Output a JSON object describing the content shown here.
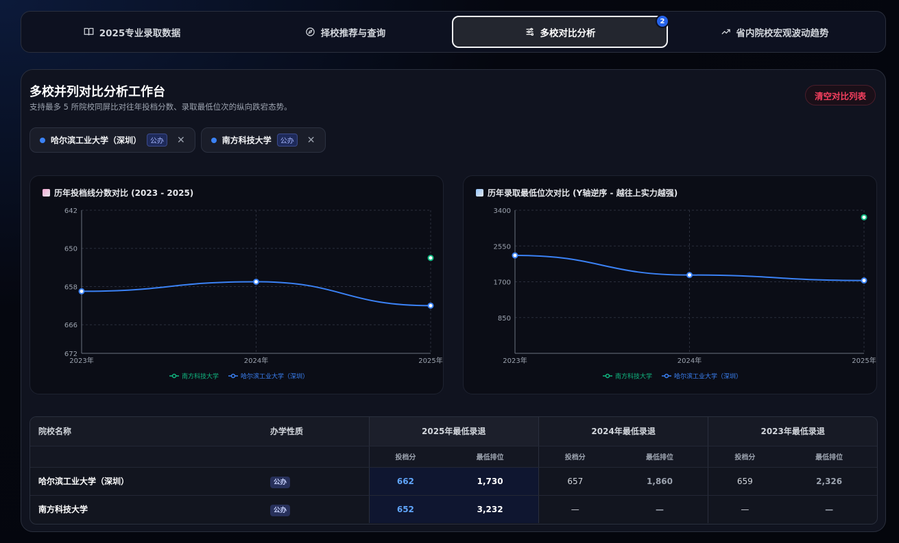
{
  "tabs": [
    {
      "label": "2025专业录取数据",
      "icon": "book-icon",
      "active": false
    },
    {
      "label": "择校推荐与查询",
      "icon": "compass-icon",
      "active": false
    },
    {
      "label": "多校对比分析",
      "icon": "sliders-icon",
      "active": true,
      "badge": "2"
    },
    {
      "label": "省内院校宏观波动趋势",
      "icon": "trend-up-icon",
      "active": false
    }
  ],
  "panel": {
    "title": "多校并列对比分析工作台",
    "subtitle": "支持最多 5 所院校同屏比对往年投档分数、录取最低位次的纵向跌宕态势。",
    "clear_label": "清空对比列表"
  },
  "chips": [
    {
      "name": "哈尔滨工业大学（深圳）",
      "tag": "公办",
      "close": "✕"
    },
    {
      "name": "南方科技大学",
      "tag": "公办",
      "close": "✕"
    }
  ],
  "colors": {
    "blue": "#3b82f6",
    "green": "#10b981",
    "accent": "#2563eb",
    "danger": "#f43f5e"
  },
  "chart_data": [
    {
      "type": "line",
      "title": "历年投档线分数对比 (2023 - 2025)",
      "x": [
        "2023年",
        "2024年",
        "2025年"
      ],
      "yticks": [
        "672",
        "666",
        "658",
        "650",
        "642"
      ],
      "ylim": [
        642,
        672
      ],
      "grid": true,
      "legend": "bottom",
      "series": [
        {
          "name": "南方科技大学",
          "color": "#10b981",
          "values": [
            null,
            null,
            652
          ]
        },
        {
          "name": "哈尔滨工业大学（深圳）",
          "color": "#3b82f6",
          "values": [
            659,
            657,
            662
          ]
        }
      ]
    },
    {
      "type": "line",
      "title": "历年录取最低位次对比 (Y轴逆序 - 越往上实力越强)",
      "x": [
        "2023年",
        "2024年",
        "2025年"
      ],
      "yticks": [
        "850",
        "1700",
        "2550",
        "3400"
      ],
      "ylim": [
        3400,
        0
      ],
      "inverted": true,
      "grid": true,
      "legend": "bottom",
      "series": [
        {
          "name": "南方科技大学",
          "color": "#10b981",
          "values": [
            null,
            null,
            3232
          ]
        },
        {
          "name": "哈尔滨工业大学（深圳）",
          "color": "#3b82f6",
          "values": [
            2326,
            1860,
            1730
          ]
        }
      ]
    }
  ],
  "table": {
    "col_name": "院校名称",
    "col_type": "办学性质",
    "groups": [
      "2025年最低录退",
      "2024年最低录退",
      "2023年最低录退"
    ],
    "sub_score": "投档分",
    "sub_rank": "最低排位",
    "rows": [
      {
        "name": "哈尔滨工业大学（深圳）",
        "type": "公办",
        "s2025": "662",
        "r2025": "1,730",
        "s2024": "657",
        "r2024": "1,860",
        "s2023": "659",
        "r2023": "2,326"
      },
      {
        "name": "南方科技大学",
        "type": "公办",
        "s2025": "652",
        "r2025": "3,232",
        "s2024": "—",
        "r2024": "—",
        "s2023": "—",
        "r2023": "—"
      }
    ]
  }
}
